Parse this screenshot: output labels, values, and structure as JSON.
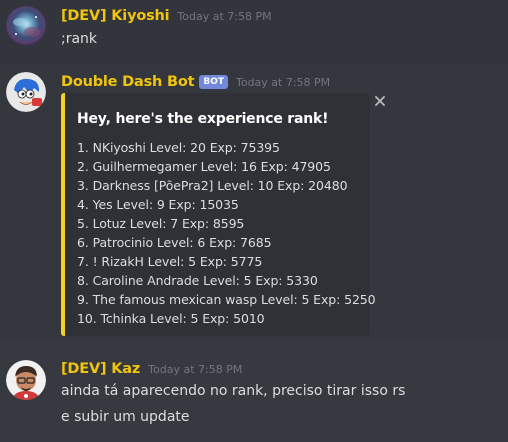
{
  "messages": [
    {
      "username": "[DEV] Kiyoshi",
      "timestamp": "Today at 7:58 PM",
      "username_color": "#f1c40f",
      "text": ";rank"
    },
    {
      "username": "Double Dash Bot",
      "bot_tag": "BOT",
      "timestamp": "Today at 7:58 PM",
      "username_color": "#f1c40f",
      "embed": {
        "color": "#f4d21f",
        "title": "Hey, here's the experience rank!",
        "close_icon": "close-icon",
        "items": [
          "1. NKiyoshi Level: 20 Exp: 75395",
          "2. Guilhermegamer Level: 16 Exp: 47905",
          "3. Darkness [PõePra2] Level: 10 Exp: 20480",
          "4. Yes Level: 9 Exp: 15035",
          "5. Lotuz Level: 7 Exp: 8595",
          "6. Patrocinio Level: 6 Exp: 7685",
          "7. ! RizakH Level: 5 Exp: 5775",
          "8. Caroline Andrade Level: 5 Exp: 5330",
          "9. The famous mexican wasp Level: 5 Exp: 5250",
          "10. Tchinka Level: 5 Exp: 5010"
        ]
      }
    },
    {
      "username": "[DEV] Kaz",
      "timestamp": "Today at 7:58 PM",
      "username_color": "#f1c40f",
      "text_lines": [
        "ainda tá aparecendo no rank, preciso tirar isso rs",
        "e subir um update"
      ]
    }
  ]
}
